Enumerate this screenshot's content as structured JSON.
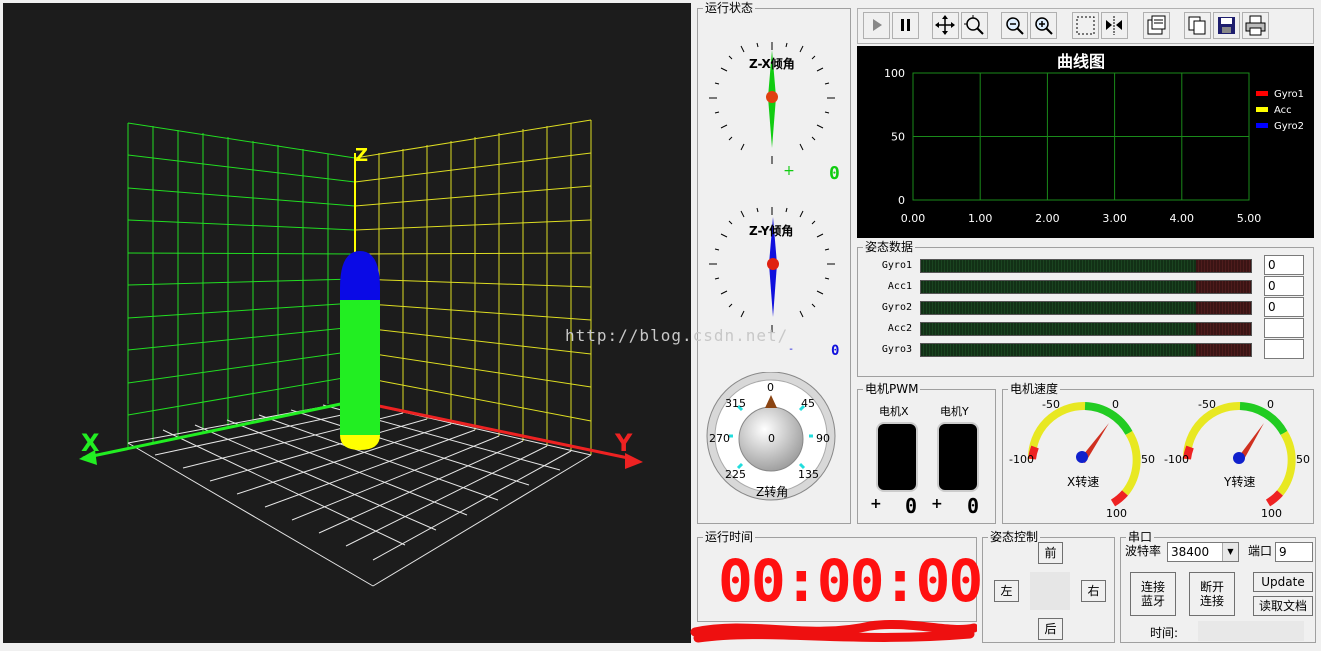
{
  "scene3d": {
    "axis_x": "X",
    "axis_y": "Y",
    "axis_z": "Z"
  },
  "status_group": {
    "title": "运行状态"
  },
  "dial_zx": {
    "title": "Z-X倾角",
    "readout": "0"
  },
  "dial_zy": {
    "title": "Z-Y倾角",
    "readout": "0"
  },
  "compass": {
    "label": "Z转角",
    "center": "0",
    "ticks": [
      "0",
      "45",
      "90",
      "135",
      "225",
      "270",
      "315"
    ]
  },
  "toolbar": {
    "icons": [
      "play-icon",
      "pause-icon",
      "move-icon",
      "zoom-fit-icon",
      "zoom-out-icon",
      "zoom-in-icon",
      "select-rect-icon",
      "flip-icon",
      "properties-icon",
      "copy-icon",
      "save-icon",
      "print-icon"
    ]
  },
  "chart_data": {
    "type": "line",
    "title": "曲线图",
    "xlim": [
      0,
      5
    ],
    "ylim": [
      0,
      100
    ],
    "xticks": [
      "0.00",
      "1.00",
      "2.00",
      "3.00",
      "4.00",
      "5.00"
    ],
    "yticks": [
      "0",
      "50",
      "100"
    ],
    "series": [
      {
        "name": "Gyro1",
        "color": "#ff0000",
        "values": []
      },
      {
        "name": "Acc",
        "color": "#ffff00",
        "values": []
      },
      {
        "name": "Gyro2",
        "color": "#0000ff",
        "values": []
      }
    ],
    "legend": "top-right",
    "grid": true
  },
  "attitude": {
    "title": "姿态数据",
    "rows": [
      {
        "label": "Gyro1",
        "value": "0"
      },
      {
        "label": "Acc1",
        "value": "0"
      },
      {
        "label": "Gyro2",
        "value": "0"
      },
      {
        "label": "Acc2",
        "value": ""
      },
      {
        "label": "Gyro3",
        "value": ""
      }
    ]
  },
  "pwm": {
    "title": "电机PWM",
    "motor_x": "电机X",
    "motor_y": "电机Y",
    "x_sign": "+",
    "x_value": "0",
    "y_sign": "+",
    "y_value": "0"
  },
  "speed": {
    "title": "电机速度",
    "x_label": "X转速",
    "y_label": "Y转速",
    "ticks": [
      "-100",
      "-50",
      "0",
      "50",
      "100"
    ]
  },
  "runtime": {
    "title": "运行时间",
    "value": "00:00:00"
  },
  "control": {
    "title": "姿态控制",
    "front": "前",
    "back": "后",
    "left": "左",
    "right": "右"
  },
  "serial": {
    "title": "串口",
    "baud_label": "波特率",
    "baud_value": "38400",
    "port_label": "端口",
    "port_value": "9",
    "connect_bt": "连接蓝牙",
    "disconnect": "断开连接",
    "update": "Update",
    "read_doc": "读取文档",
    "time_label": "时间:"
  },
  "watermark": "http://blog.csdn.net/"
}
